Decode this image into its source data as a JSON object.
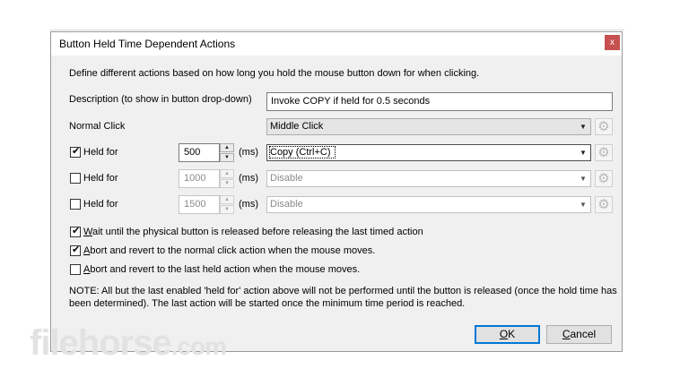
{
  "window": {
    "title": "Button Held Time Dependent Actions",
    "close_symbol": "x"
  },
  "intro": "Define different actions based on how long you hold the mouse button down for when clicking.",
  "description": {
    "label": "Description (to show in button drop-down)",
    "value": "Invoke COPY if held for 0.5 seconds"
  },
  "normal_click": {
    "label": "Normal Click",
    "selected": "Middle Click"
  },
  "held_rows": [
    {
      "label": "Held for",
      "checked": true,
      "ms": "500",
      "unit": "(ms)",
      "action": "Copy (Ctrl+C)",
      "enabled": true
    },
    {
      "label": "Held for",
      "checked": false,
      "ms": "1000",
      "unit": "(ms)",
      "action": "Disable",
      "enabled": false
    },
    {
      "label": "Held for",
      "checked": false,
      "ms": "1500",
      "unit": "(ms)",
      "action": "Disable",
      "enabled": false
    }
  ],
  "options": [
    {
      "mnemonic": "W",
      "rest": "ait until the physical button is released before releasing the last timed action",
      "checked": true
    },
    {
      "mnemonic": "A",
      "rest": "bort and revert to the normal click action when the mouse moves.",
      "checked": true
    },
    {
      "mnemonic": "A",
      "rest": "bort and revert to the last held action when the mouse moves.",
      "checked": false
    }
  ],
  "note": {
    "line1": "NOTE: All but the last enabled 'held for' action above will not be performed until the button is released (once the hold time has",
    "line2": "been determined). The last action will be started once the minimum time period is reached."
  },
  "buttons": {
    "ok": {
      "mnemonic": "O",
      "rest": "K"
    },
    "cancel": {
      "mnemonic": "C",
      "rest": "ancel"
    }
  },
  "watermark": {
    "main": "filehorse",
    "suffix": ".com"
  },
  "icons": {
    "gear": "gear-icon",
    "dropdown": "chevron-down-icon",
    "check": "check-icon"
  }
}
